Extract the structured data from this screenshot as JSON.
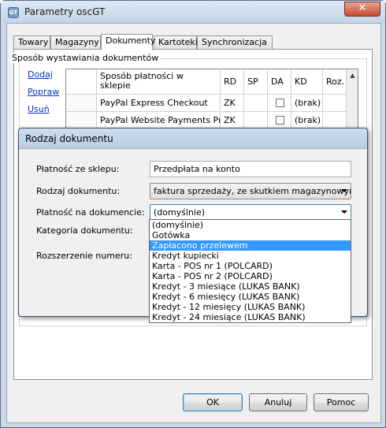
{
  "window": {
    "title": "Parametry oscGT",
    "close_label": "✕",
    "app_icon_text": "GT"
  },
  "tabs": [
    {
      "label": "Towary"
    },
    {
      "label": "Magazyny"
    },
    {
      "label": "Dokumenty",
      "active": true
    },
    {
      "label": "Kartoteki"
    },
    {
      "label": "Synchronizacja"
    }
  ],
  "group": {
    "title": "Sposób wystawiania dokumentów"
  },
  "links": {
    "add": "Dodaj",
    "edit": "Popraw",
    "delete": "Usuń"
  },
  "grid": {
    "headers": {
      "payment": "Sposób płatności w sklepie",
      "rd": "RD",
      "sp": "SP",
      "da": "DA",
      "kd": "KD",
      "roz": "Roz."
    },
    "rows": [
      {
        "payment": "PayPal Express Checkout",
        "rd": "ZK",
        "sp": "",
        "da": false,
        "kd": "(brak)",
        "roz": ""
      },
      {
        "payment": "PayPal Website Payments Pr...",
        "rd": "ZK",
        "sp": "",
        "da": false,
        "kd": "(brak)",
        "roz": ""
      }
    ]
  },
  "dialog": {
    "title": "Rodzaj dokumentu",
    "fields": {
      "store_payment_label": "Płatność ze sklepu:",
      "store_payment_value": "Przedpłata na konto",
      "doc_type_label": "Rodzaj dokumentu:",
      "doc_type_value": "faktura sprzedaży, ze skutkiem magazynowym",
      "doc_payment_label": "Płatność na dokumencie:",
      "doc_payment_value": "(domyślnie)",
      "doc_category_label": "Kategoria dokumentu:",
      "number_ext_label": "Rozszerzenie numeru:"
    },
    "dropdown_options": [
      "(domyślnie)",
      "Gotówka",
      "Zapłacono przelewem",
      "Kredyt kupiecki",
      "Karta - POS nr 1 (POLCARD)",
      "Karta - POS nr 2 (POLCARD)",
      "Kredyt - 3 miesiące (LUKAS BANK)",
      "Kredyt - 6 miesięcy (LUKAS BANK)",
      "Kredyt - 12 miesięcy (LUKAS BANK)",
      "Kredyt - 24 miesiące (LUKAS BANK)"
    ],
    "dropdown_selected": "Zapłacono przelewem"
  },
  "buttons": {
    "ok": "OK",
    "cancel": "Anuluj",
    "help": "Pomoc"
  }
}
